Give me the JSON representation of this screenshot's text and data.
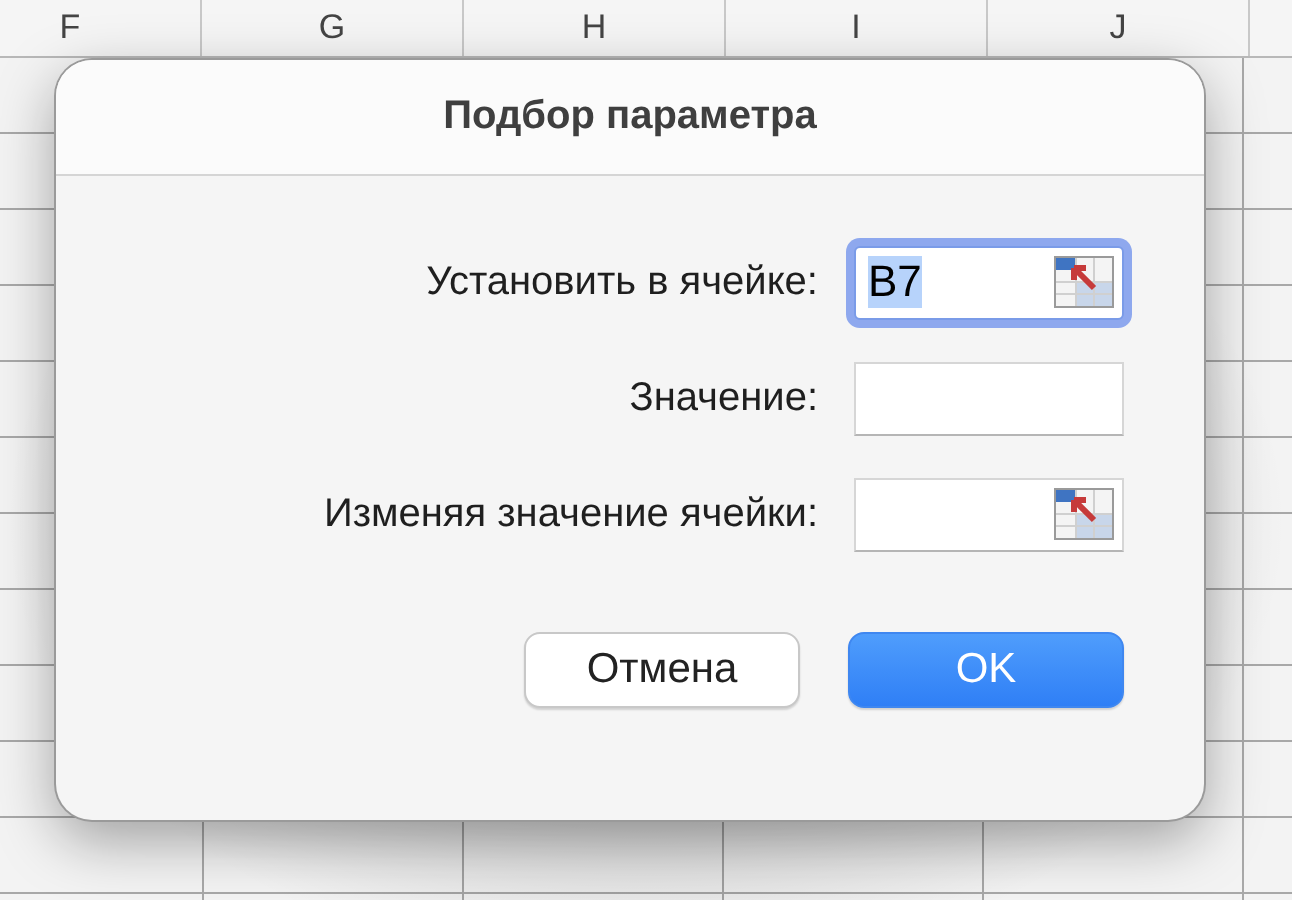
{
  "sheet": {
    "columns": [
      "F",
      "G",
      "H",
      "I",
      "J"
    ]
  },
  "dialog": {
    "title": "Подбор параметра",
    "fields": [
      {
        "kind": "reference",
        "label": "Установить в ячейке:",
        "value": "B7",
        "focused": true
      },
      {
        "kind": "text",
        "label": "Значение:",
        "focused": false
      },
      {
        "kind": "reference",
        "label": "Изменяя значение ячейки:",
        "focused": false
      }
    ],
    "buttons": [
      {
        "label": "Отмена",
        "default": false
      },
      {
        "label": "OK",
        "default": true
      }
    ]
  }
}
